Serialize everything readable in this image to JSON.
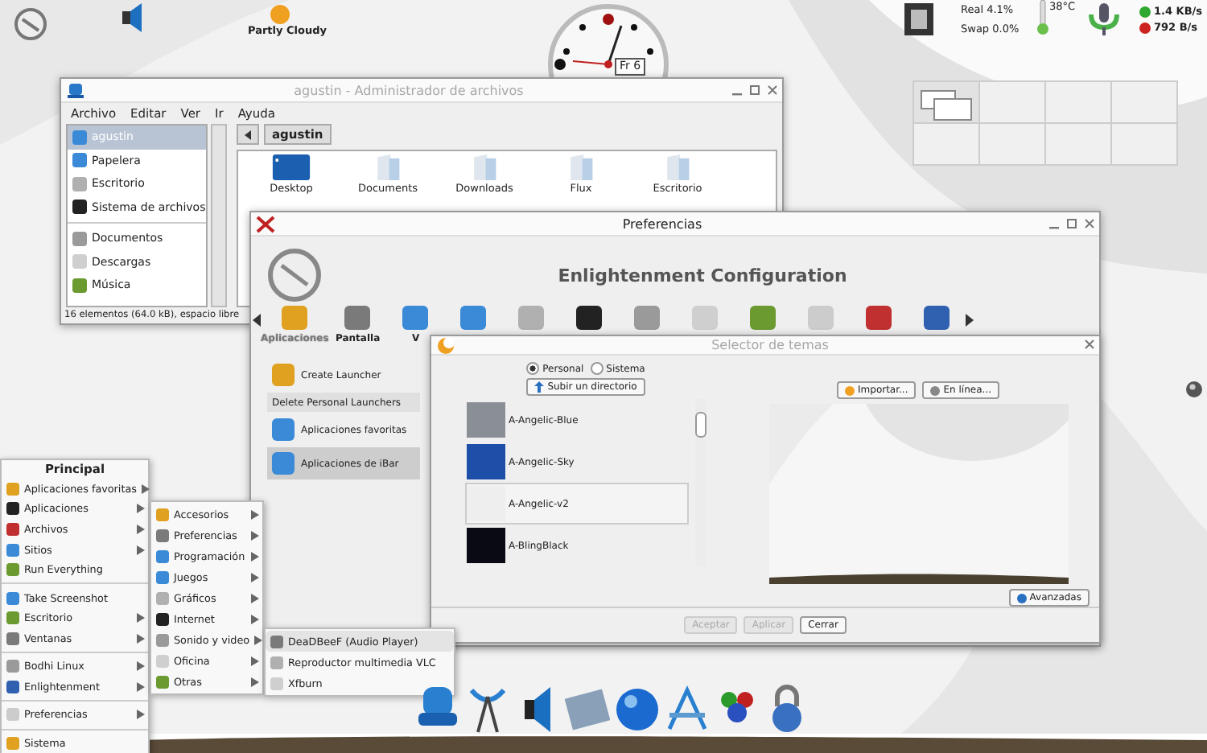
{
  "top_panel": {
    "weather_label": "Partly Cloudy",
    "clock_date": "Fr 6",
    "memory": [
      "Real 4.1%",
      "Swap 0.0%"
    ],
    "temperature": "38°C",
    "network": [
      {
        "reading": "1.4 KB/s",
        "color": "#2fa82f"
      },
      {
        "reading": "792 B/s",
        "color": "#cc2222"
      }
    ]
  },
  "pager": {
    "desks": [
      {
        "selected": true
      },
      {
        "selected": false
      },
      {
        "selected": false
      },
      {
        "selected": false
      },
      {
        "selected": false
      },
      {
        "selected": false
      },
      {
        "selected": false
      },
      {
        "selected": false
      }
    ]
  },
  "file_manager": {
    "title": "agustin - Administrador de archivos",
    "menu": [
      "Archivo",
      "Editar",
      "Ver",
      "Ir",
      "Ayuda"
    ],
    "places": [
      {
        "label": "agustin",
        "selected": true
      },
      {
        "label": "Papelera",
        "selected": false
      },
      {
        "label": "Escritorio",
        "selected": false
      },
      {
        "label": "Sistema de archivos",
        "selected": false
      },
      {
        "label": "Documentos",
        "selected": false
      },
      {
        "label": "Descargas",
        "selected": false
      },
      {
        "label": "Música",
        "selected": false
      }
    ],
    "path": "agustin",
    "items": [
      "Desktop",
      "Documents",
      "Downloads",
      "Flux",
      "Escritorio"
    ],
    "status": "16 elementos (64.0 kB), espacio libre"
  },
  "preferences": {
    "title": "Preferencias",
    "heading": "Enlightenment Configuration",
    "categories": [
      {
        "label": "Aplicaciones",
        "selected": true
      },
      {
        "label": "Pantalla",
        "selected": false
      },
      {
        "label": "V",
        "selected": false
      }
    ],
    "launchers": [
      {
        "label": "Create Launcher",
        "kind": "icon",
        "selected": false
      },
      {
        "label": "Delete Personal Launchers",
        "kind": "plain",
        "selected": false
      },
      {
        "label": "Aplicaciones favoritas",
        "kind": "icon",
        "selected": false
      },
      {
        "label": "Aplicaciones de iBar",
        "kind": "icon",
        "selected": true
      }
    ]
  },
  "theme_selector": {
    "title": "Selector de temas",
    "sources": [
      {
        "label": "Personal",
        "selected": true
      },
      {
        "label": "Sistema",
        "selected": false
      }
    ],
    "up_button": "Subir un directorio",
    "themes": [
      {
        "name": "A-Angelic-Blue",
        "color": "#8a8f96",
        "selected": false
      },
      {
        "name": "A-Angelic-Sky",
        "color": "#1d4fa8",
        "selected": false
      },
      {
        "name": "A-Angelic-v2",
        "color": "#eeeeee",
        "selected": true
      },
      {
        "name": "A-BlingBlack",
        "color": "#0a0a14",
        "selected": false
      }
    ],
    "import_button": "Importar...",
    "online_button": "En línea...",
    "advanced_button": "Avanzadas",
    "buttons": [
      {
        "label": "Aceptar",
        "disabled": true
      },
      {
        "label": "Aplicar",
        "disabled": true
      },
      {
        "label": "Cerrar",
        "disabled": false
      }
    ]
  },
  "main_menu": {
    "title": "Principal",
    "sections": [
      {
        "items": [
          {
            "label": "Aplicaciones favoritas",
            "submenu": true
          },
          {
            "label": "Aplicaciones",
            "submenu": true
          },
          {
            "label": "Archivos",
            "submenu": true
          },
          {
            "label": "Sitios",
            "submenu": true
          },
          {
            "label": "Run Everything",
            "submenu": false
          }
        ]
      },
      {
        "items": [
          {
            "label": "Take Screenshot",
            "submenu": false
          },
          {
            "label": "Escritorio",
            "submenu": true
          },
          {
            "label": "Ventanas",
            "submenu": true
          }
        ]
      },
      {
        "items": [
          {
            "label": "Bodhi Linux",
            "submenu": true
          },
          {
            "label": "Enlightenment",
            "submenu": true
          }
        ]
      },
      {
        "items": [
          {
            "label": "Preferencias",
            "submenu": true
          }
        ]
      },
      {
        "items": [
          {
            "label": "Sistema",
            "submenu": false
          }
        ]
      }
    ]
  },
  "applications_menu": {
    "items": [
      {
        "label": "Accesorios",
        "submenu": true
      },
      {
        "label": "Preferencias",
        "submenu": true
      },
      {
        "label": "Programación",
        "submenu": true
      },
      {
        "label": "Juegos",
        "submenu": true
      },
      {
        "label": "Gráficos",
        "submenu": true
      },
      {
        "label": "Internet",
        "submenu": true
      },
      {
        "label": "Sonido y video",
        "submenu": true
      },
      {
        "label": "Oficina",
        "submenu": true
      },
      {
        "label": "Otras",
        "submenu": true
      }
    ]
  },
  "sound_menu": {
    "items": [
      {
        "label": "DeaDBeeF (Audio Player)",
        "selected": true
      },
      {
        "label": "Reproductor multimedia VLC",
        "selected": false
      },
      {
        "label": "Xfburn",
        "selected": false
      }
    ]
  }
}
